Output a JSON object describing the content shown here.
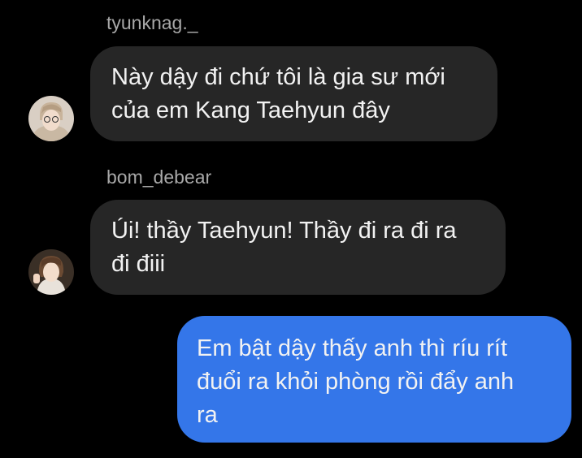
{
  "messages": [
    {
      "sender": "tyunknag._",
      "avatar_icon": "avatar-tyunknag",
      "lines": [
        "Này dậy đi chứ tôi là gia sư mới",
        "của em Kang Taehyun đây"
      ]
    },
    {
      "sender": "bom_debear",
      "avatar_icon": "avatar-bom-debear",
      "lines": [
        "Úi! thầy Taehyun! Thầy đi ra đi ra",
        "đi điii"
      ]
    },
    {
      "sender": "",
      "outgoing": true,
      "lines": [
        "Em bật dậy thấy anh thì ríu rít",
        "đuổi ra khỏi phòng rồi đẩy anh",
        "ra"
      ]
    }
  ],
  "colors": {
    "background": "#000000",
    "incoming_bubble": "#262626",
    "outgoing_bubble": "#3476e9",
    "sender_name": "#a8a8a8",
    "message_text": "#f2f2f2"
  }
}
